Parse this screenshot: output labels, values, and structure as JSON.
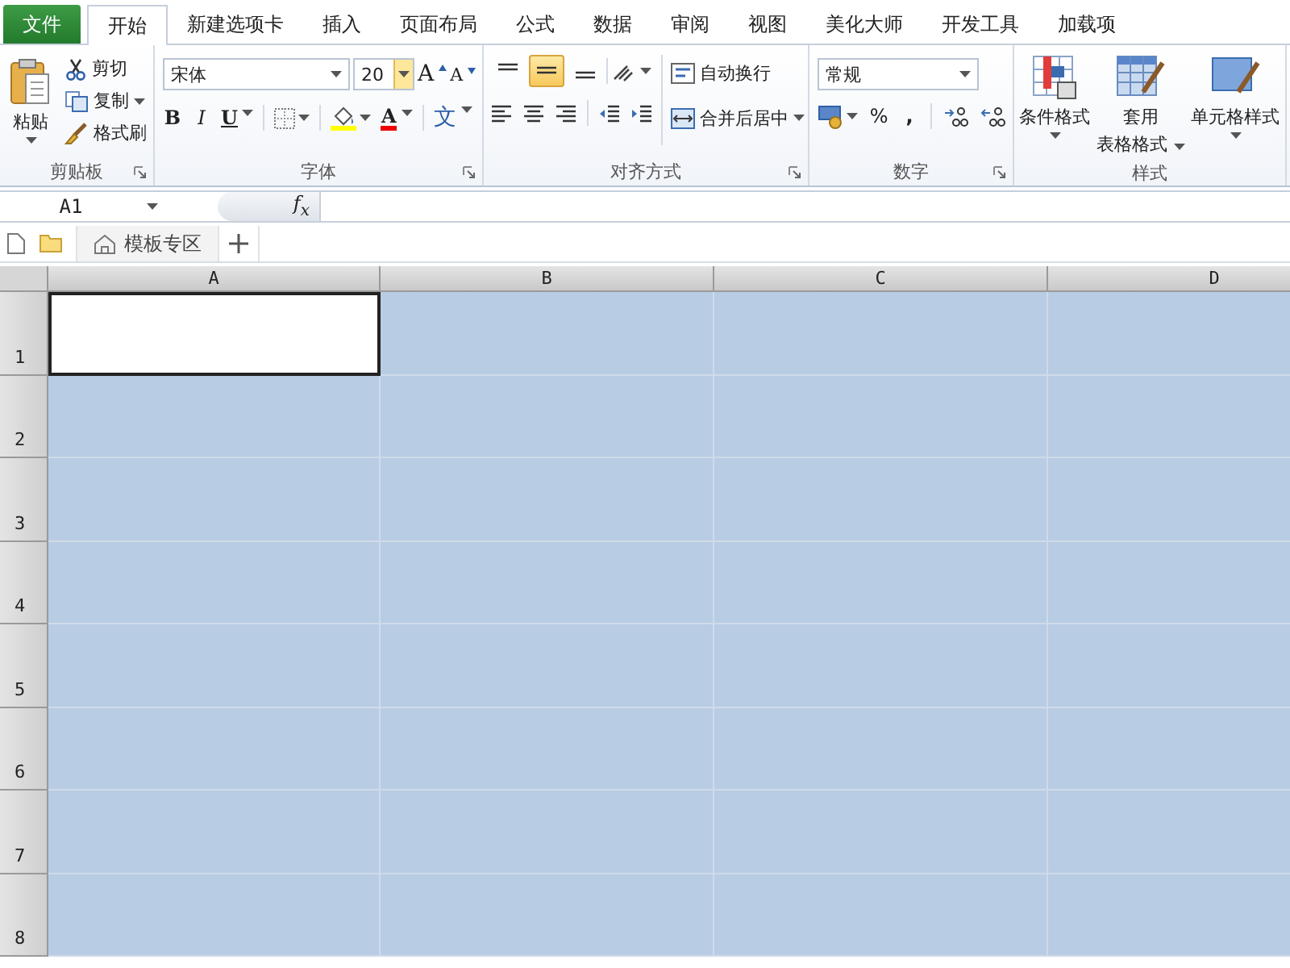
{
  "ribbon_tabs": [
    {
      "label": "文件",
      "kind": "file",
      "selected": false
    },
    {
      "label": "开始",
      "kind": "tab",
      "selected": true
    },
    {
      "label": "新建选项卡",
      "kind": "tab",
      "selected": false
    },
    {
      "label": "插入",
      "kind": "tab",
      "selected": false
    },
    {
      "label": "页面布局",
      "kind": "tab",
      "selected": false
    },
    {
      "label": "公式",
      "kind": "tab",
      "selected": false
    },
    {
      "label": "数据",
      "kind": "tab",
      "selected": false
    },
    {
      "label": "审阅",
      "kind": "tab",
      "selected": false
    },
    {
      "label": "视图",
      "kind": "tab",
      "selected": false
    },
    {
      "label": "美化大师",
      "kind": "tab",
      "selected": false
    },
    {
      "label": "开发工具",
      "kind": "tab",
      "selected": false
    },
    {
      "label": "加载项",
      "kind": "tab",
      "selected": false
    }
  ],
  "ribbon_groups": [
    {
      "kind": "clipboard",
      "title": "剪贴板",
      "launcher": true,
      "paste": "粘贴",
      "cut": "剪切",
      "copy": "复制",
      "format_painter": "格式刷"
    },
    {
      "kind": "font",
      "title": "字体",
      "launcher": true,
      "font_name": "宋体",
      "font_size": "20",
      "grow": "A",
      "shrink": "A",
      "bold": "B",
      "italic": "I",
      "underline": "U",
      "font_color": "A",
      "phonetic": "文"
    },
    {
      "kind": "alignment",
      "title": "对齐方式",
      "launcher": true,
      "wrap_text": "自动换行",
      "merge_center": "合并后居中",
      "vertical_align": [
        {
          "selected": false
        },
        {
          "selected": true
        },
        {
          "selected": false
        }
      ]
    },
    {
      "kind": "number",
      "title": "数字",
      "launcher": true,
      "format": "常规",
      "percent": "%",
      "comma": ","
    },
    {
      "kind": "styles",
      "title": "样式",
      "launcher": false,
      "buttons": [
        {
          "lines": [
            "条件格式"
          ]
        },
        {
          "lines": [
            "套用",
            "表格格式"
          ]
        },
        {
          "lines": [
            "单元格样式"
          ]
        }
      ]
    }
  ],
  "formula_bar": {
    "name_box": "A1",
    "function_label": "f$_{x}$"
  },
  "doc_tabs": [
    {
      "label": "模板专区"
    }
  ],
  "sheet": {
    "columns": [
      "A",
      "B",
      "C",
      "D"
    ],
    "rows": [
      {
        "header": "1",
        "cells": [
          {
            "selected": false
          },
          {
            "selected": true
          },
          {
            "selected": true
          },
          {
            "selected": true
          }
        ]
      },
      {
        "header": "2",
        "cells": [
          {
            "selected": true
          },
          {
            "selected": true
          },
          {
            "selected": true
          },
          {
            "selected": true
          }
        ]
      },
      {
        "header": "3",
        "cells": [
          {
            "selected": true
          },
          {
            "selected": true
          },
          {
            "selected": true
          },
          {
            "selected": true
          }
        ]
      },
      {
        "header": "4",
        "cells": [
          {
            "selected": true
          },
          {
            "selected": true
          },
          {
            "selected": true
          },
          {
            "selected": true
          }
        ]
      },
      {
        "header": "5",
        "cells": [
          {
            "selected": true
          },
          {
            "selected": true
          },
          {
            "selected": true
          },
          {
            "selected": true
          }
        ]
      },
      {
        "header": "6",
        "cells": [
          {
            "selected": true
          },
          {
            "selected": true
          },
          {
            "selected": true
          },
          {
            "selected": true
          }
        ]
      },
      {
        "header": "7",
        "cells": [
          {
            "selected": true
          },
          {
            "selected": true
          },
          {
            "selected": true
          },
          {
            "selected": true
          }
        ]
      },
      {
        "header": "8",
        "cells": [
          {
            "selected": true
          },
          {
            "selected": true
          },
          {
            "selected": true
          },
          {
            "selected": true
          }
        ]
      }
    ]
  }
}
